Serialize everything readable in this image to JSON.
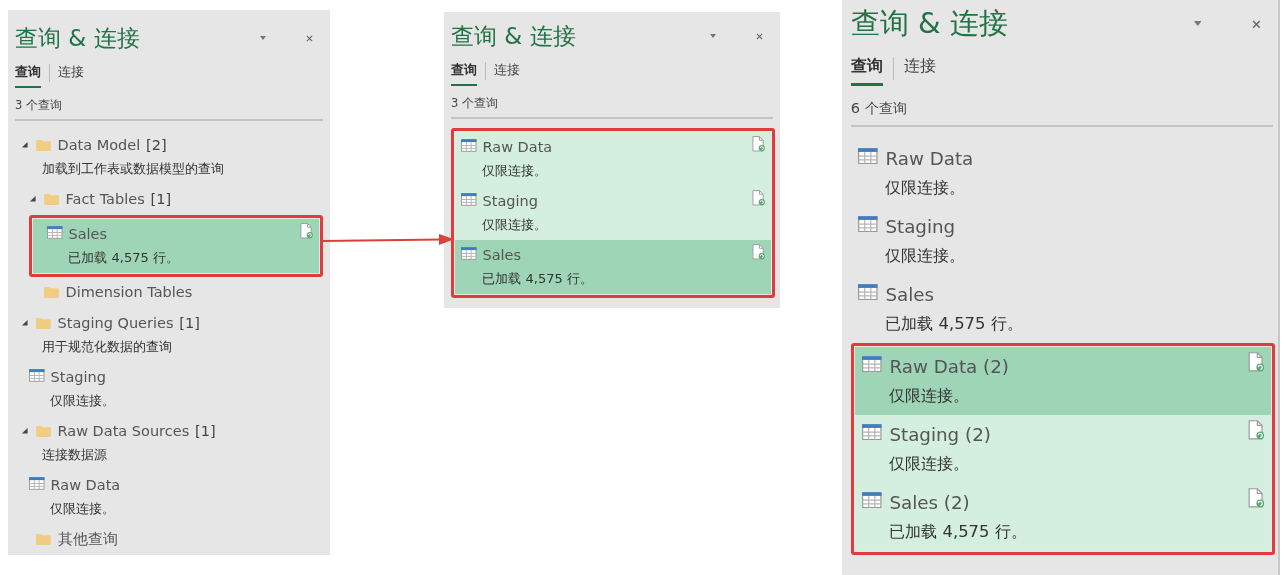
{
  "panels": [
    {
      "title": "查询 & 连接",
      "tabs": [
        {
          "label": "查询",
          "selected": true
        },
        {
          "label": "连接",
          "selected": false
        }
      ],
      "count": "3 个查询",
      "items": [
        {
          "kind": "folder",
          "name": "Data Model",
          "count": "[2]",
          "description": "加载到工作表或数据模型的查询",
          "expanded": true,
          "selected": false,
          "focused": false,
          "children": [
            {
              "kind": "folder",
              "name": "Fact Tables",
              "count": "[1]",
              "expanded": true,
              "selected": false,
              "focused": false,
              "children": [
                {
                  "kind": "query",
                  "name": "Sales",
                  "description": "已加载 4,575 行。",
                  "selected": true,
                  "focused": true
                }
              ]
            },
            {
              "kind": "folder",
              "name": "Dimension Tables",
              "selected": false,
              "focused": false
            }
          ]
        },
        {
          "kind": "folder",
          "name": "Staging Queries",
          "count": "[1]",
          "description": "用于规范化数据的查询",
          "expanded": true,
          "selected": false,
          "focused": false,
          "children": [
            {
              "kind": "query",
              "name": "Staging",
              "description": "仅限连接。",
              "selected": false,
              "focused": false
            }
          ]
        },
        {
          "kind": "folder",
          "name": "Raw Data Sources",
          "count": "[1]",
          "description": "连接数据源",
          "expanded": true,
          "selected": false,
          "focused": false,
          "children": [
            {
              "kind": "query",
              "name": "Raw Data",
              "description": "仅限连接。",
              "selected": false,
              "focused": false
            }
          ]
        },
        {
          "kind": "folder",
          "name": "其他查询",
          "selected": false,
          "focused": false
        }
      ]
    },
    {
      "title": "查询 & 连接",
      "tabs": [
        {
          "label": "查询",
          "selected": true
        },
        {
          "label": "连接",
          "selected": false
        }
      ],
      "count": "3 个查询",
      "items": [
        {
          "kind": "query",
          "name": "Raw Data",
          "description": "仅限连接。",
          "selected": true,
          "focused": false
        },
        {
          "kind": "query",
          "name": "Staging",
          "description": "仅限连接。",
          "selected": true,
          "focused": false
        },
        {
          "kind": "query",
          "name": "Sales",
          "description": "已加载 4,575 行。",
          "selected": true,
          "focused": true
        }
      ]
    },
    {
      "title": "查询 & 连接",
      "tabs": [
        {
          "label": "查询",
          "selected": true
        },
        {
          "label": "连接",
          "selected": false
        }
      ],
      "count": "6 个查询",
      "items": [
        {
          "kind": "query",
          "name": "Raw Data",
          "description": "仅限连接。",
          "selected": false,
          "focused": false
        },
        {
          "kind": "query",
          "name": "Staging",
          "description": "仅限连接。",
          "selected": false,
          "focused": false
        },
        {
          "kind": "query",
          "name": "Sales",
          "description": "已加载 4,575 行。",
          "selected": false,
          "focused": false
        },
        {
          "kind": "query",
          "name": "Raw Data (2)",
          "description": "仅限连接。",
          "selected": true,
          "focused": true
        },
        {
          "kind": "query",
          "name": "Staging (2)",
          "description": "仅限连接。",
          "selected": true,
          "focused": false
        },
        {
          "kind": "query",
          "name": "Sales (2)",
          "description": "已加载 4,575 行。",
          "selected": true,
          "focused": false
        }
      ]
    }
  ]
}
